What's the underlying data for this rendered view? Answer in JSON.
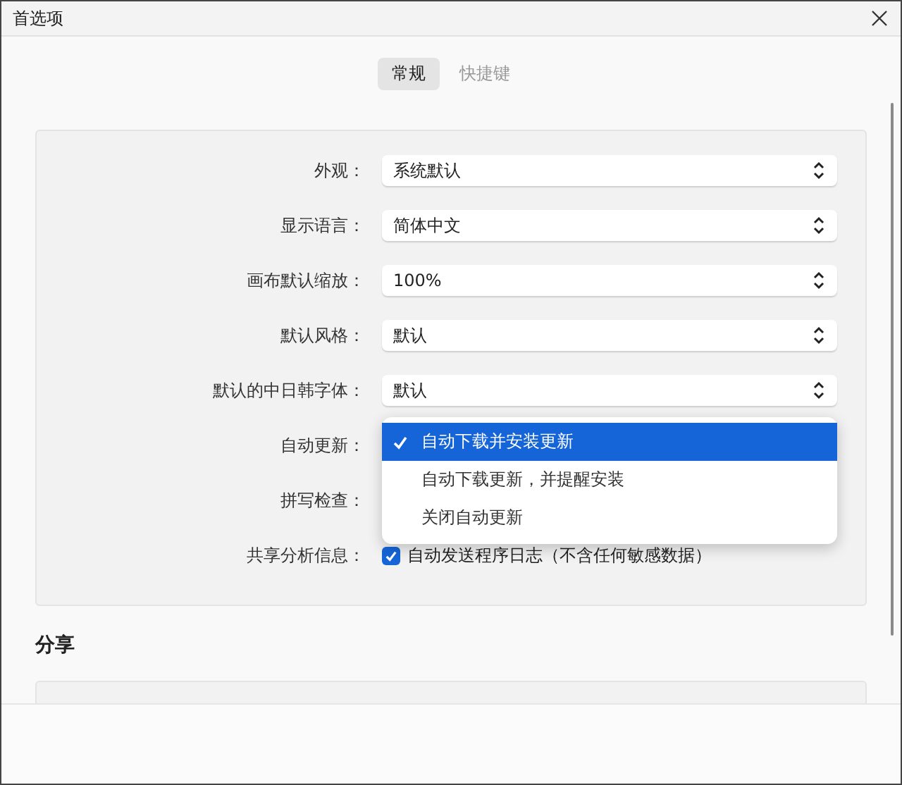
{
  "window": {
    "title": "首选项"
  },
  "tabs": [
    {
      "label": "常规",
      "selected": true
    },
    {
      "label": "快捷键",
      "selected": false
    }
  ],
  "settings": [
    {
      "kind": "select",
      "label": "外观：",
      "value": "系统默认"
    },
    {
      "kind": "select",
      "label": "显示语言：",
      "value": "简体中文"
    },
    {
      "kind": "select",
      "label": "画布默认缩放：",
      "value": "100%"
    },
    {
      "kind": "select",
      "label": "默认风格：",
      "value": "默认"
    },
    {
      "kind": "select",
      "label": "默认的中日韩字体：",
      "value": "默认"
    },
    {
      "kind": "menu",
      "label": "自动更新：",
      "options": [
        {
          "label": "自动下载并安装更新",
          "selected": true
        },
        {
          "label": "自动下载更新，并提醒安装",
          "selected": false
        },
        {
          "label": "关闭自动更新",
          "selected": false
        }
      ]
    },
    {
      "kind": "covered",
      "label": "拼写检查："
    },
    {
      "kind": "checkbox",
      "label": "共享分析信息：",
      "checked": true,
      "text": "自动发送程序日志（不含任何敏感数据）"
    }
  ],
  "share": {
    "title": "分享"
  }
}
